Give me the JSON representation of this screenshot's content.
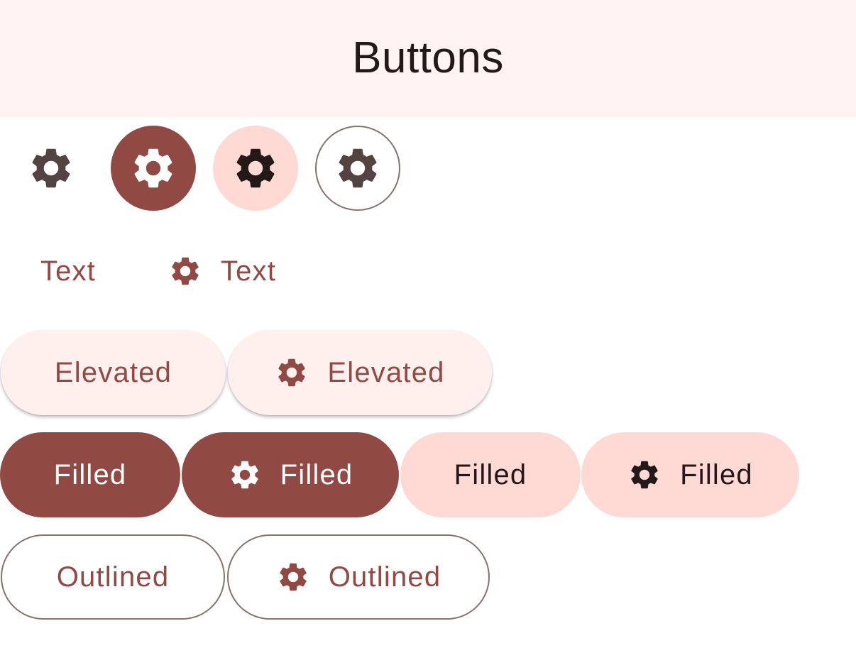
{
  "appbar": {
    "title": "Buttons"
  },
  "icons": {
    "settings": "gear-icon"
  },
  "buttons": {
    "text": "Text",
    "text_with_icon": "Text",
    "elevated": "Elevated",
    "elevated_with_icon": "Elevated",
    "filled": "Filled",
    "filled_with_icon": "Filled",
    "tonal": "Filled",
    "tonal_with_icon": "Filled",
    "outlined": "Outlined",
    "outlined_with_icon": "Outlined"
  },
  "colors": {
    "primary": "#904a43",
    "on_primary": "#ffffff",
    "secondary_container": "#ffdad5",
    "on_secondary_container": "#231918",
    "surface_container_low": "#fff0ee",
    "appbar_background": "#fff4f2",
    "outline": "#857370",
    "on_surface_variant": "#534341"
  }
}
